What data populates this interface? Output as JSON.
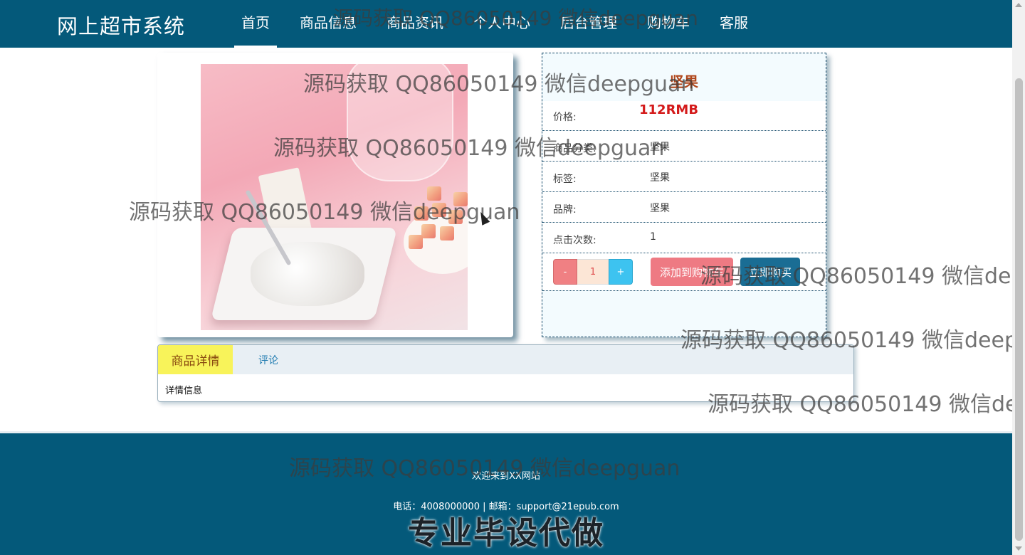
{
  "header": {
    "brand": "网上超市系统",
    "nav": [
      "首页",
      "商品信息",
      "商品资讯",
      "个人中心",
      "后台管理",
      "购物车",
      "客服"
    ],
    "active_index": 0
  },
  "product": {
    "title": "坚果",
    "price_label": "价格:",
    "price_value": "112RMB",
    "rows": [
      {
        "label": "商品分类:",
        "value": "坚果"
      },
      {
        "label": "标签:",
        "value": "坚果"
      },
      {
        "label": "品牌:",
        "value": "坚果"
      },
      {
        "label": "点击次数:",
        "value": "1"
      }
    ],
    "quantity": {
      "minus": "-",
      "value": "1",
      "plus": "+"
    },
    "add_to_cart": "添加到购物车",
    "buy_now": "立即购买"
  },
  "tabs": {
    "items": [
      "商品详情",
      "评论"
    ],
    "content": "详情信息"
  },
  "footer": {
    "welcome": "欢迎来到XX网站",
    "contact": "电话：4008000000 | 邮箱：support@21epub.com",
    "slogan": "专业毕设代做"
  },
  "watermark_text": "源码获取 QQ86050149 微信deepguan",
  "colors": {
    "header_bg": "#04597a",
    "price": "#d41a1a",
    "title": "#b0471c",
    "cart_button": "#ee7a83",
    "buy_button": "#1a6d94",
    "active_tab": "#f8f35a"
  }
}
